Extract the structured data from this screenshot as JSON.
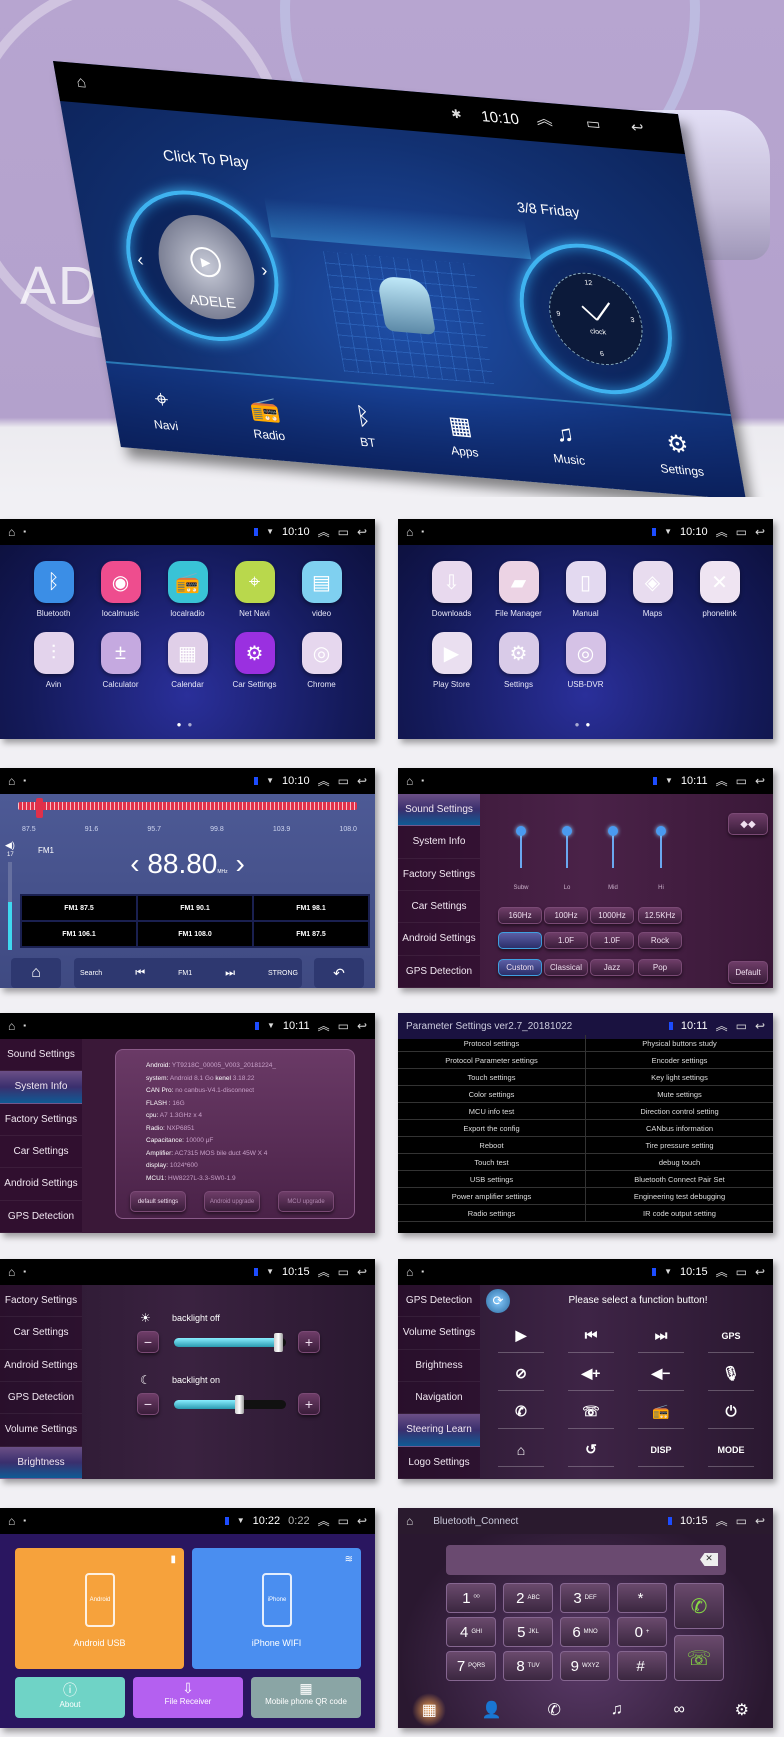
{
  "colors": {
    "accent": "#3fb3f0",
    "radio_needle": "#e0304a",
    "settings_bg": "#3a1838",
    "apps_bg": "#151c5c",
    "radio_bg": "#4a5690"
  },
  "hero": {
    "background_text": "AD",
    "time": "10:10",
    "click_to_play": "Click To Play",
    "album_text": "ADELE",
    "date": "3/8 Friday",
    "clock_label": "clock",
    "clock_numbers": [
      "12",
      "3",
      "6",
      "9"
    ],
    "dock": [
      {
        "label": "Navi",
        "icon": "location-pin-icon"
      },
      {
        "label": "Radio",
        "icon": "radio-icon"
      },
      {
        "label": "BT",
        "icon": "bluetooth-icon"
      },
      {
        "label": "Apps",
        "icon": "apps-grid-icon"
      },
      {
        "label": "Music",
        "icon": "music-note-icon"
      },
      {
        "label": "Settings",
        "icon": "gear-icon"
      }
    ]
  },
  "apps_page1": {
    "time": "10:10",
    "page": 1,
    "pages": 2,
    "apps": [
      {
        "label": "Bluetooth",
        "icon": "bluetooth-icon",
        "color": "#3b8ee6"
      },
      {
        "label": "localmusic",
        "icon": "music-disc-icon",
        "color": "#ee4d8e"
      },
      {
        "label": "localradio",
        "icon": "radio-icon",
        "color": "#39c3d6"
      },
      {
        "label": "Net Navi",
        "icon": "location-pin-icon",
        "color": "#b9d84c"
      },
      {
        "label": "video",
        "icon": "clapperboard-icon",
        "color": "#7fd0f0"
      },
      {
        "label": "Avin",
        "icon": "av-cable-icon",
        "color": "#e3d3ec"
      },
      {
        "label": "Calculator",
        "icon": "calculator-icon",
        "color": "#c5a9e0"
      },
      {
        "label": "Calendar",
        "icon": "calendar-icon",
        "color": "#e0cfe8"
      },
      {
        "label": "Car Settings",
        "icon": "gear-icon",
        "color": "#9a30e0"
      },
      {
        "label": "Chrome",
        "icon": "chrome-icon",
        "color": "#e6d7ee"
      }
    ]
  },
  "apps_page2": {
    "time": "10:10",
    "page": 2,
    "pages": 2,
    "apps": [
      {
        "label": "Downloads",
        "icon": "download-icon",
        "color": "#e8d9ee"
      },
      {
        "label": "File Manager",
        "icon": "folder-icon",
        "color": "#ecd3e4"
      },
      {
        "label": "Manual",
        "icon": "book-icon",
        "color": "#e3d9f0"
      },
      {
        "label": "Maps",
        "icon": "maps-icon",
        "color": "#e8dcef"
      },
      {
        "label": "phonelink",
        "icon": "phonelink-icon",
        "color": "#efe4f2"
      },
      {
        "label": "Play Store",
        "icon": "play-store-icon",
        "color": "#eadff0"
      },
      {
        "label": "Settings",
        "icon": "gear-icon",
        "color": "#d9cbe8"
      },
      {
        "label": "USB-DVR",
        "icon": "camera-lens-icon",
        "color": "#d5c2e6"
      }
    ]
  },
  "radio": {
    "time": "10:10",
    "scale": [
      "87.5",
      "91.6",
      "95.7",
      "99.8",
      "103.9",
      "108.0"
    ],
    "tuned_fraction": 0.063,
    "band": "FM1",
    "frequency": "88.80",
    "unit": "MHz",
    "volume": "17",
    "volume_fraction": 0.55,
    "presets": [
      "FM1 87.5",
      "FM1 90.1",
      "FM1 98.1",
      "FM1 106.1",
      "FM1 108.0",
      "FM1 87.5"
    ],
    "controls": {
      "search": "Search",
      "band": "FM1",
      "strong": "STRONG"
    }
  },
  "sound": {
    "time": "10:11",
    "menu": [
      "Sound Settings",
      "System Info",
      "Factory Settings",
      "Car Settings",
      "Android Settings",
      "GPS Detection"
    ],
    "active": 0,
    "bands": [
      {
        "label": "Subw",
        "level": 1.0
      },
      {
        "label": "Lo",
        "level": 1.0
      },
      {
        "label": "Mid",
        "level": 1.0
      },
      {
        "label": "Hi",
        "level": 1.0
      }
    ],
    "freqs": [
      "160Hz",
      "100Hz",
      "1000Hz",
      "12.5KHz"
    ],
    "q_row": [
      "",
      "1.0F",
      "1.0F",
      "Rock"
    ],
    "presets": [
      "Custom",
      "Classical",
      "Jazz",
      "Pop"
    ],
    "default": "Default"
  },
  "system_info": {
    "time": "10:11",
    "menu": [
      "Sound Settings",
      "System Info",
      "Factory Settings",
      "Car Settings",
      "Android Settings",
      "GPS Detection"
    ],
    "active": 1,
    "rows": [
      {
        "k": "Android:",
        "v": "YT9218C_00005_V003_20181224_"
      },
      {
        "k": "system:",
        "v": "Android 8.1 Go",
        "k2": "kenel",
        "v2": "3.18.22"
      },
      {
        "k": "CAN Pro:",
        "v": "no canbus-V4.1-disconnect"
      },
      {
        "k": "FLASH :",
        "v": "16G"
      },
      {
        "k": "cpu:",
        "v": "A7 1.3GHz x 4"
      },
      {
        "k": "Radio:",
        "v": "NXP6851"
      },
      {
        "k": "Capacitance:",
        "v": "10000 μF"
      },
      {
        "k": "Amplifier:",
        "v": "AC7315 MOS bile duct 45W X 4"
      },
      {
        "k": "display:",
        "v": "1024*600"
      },
      {
        "k": "MCU1:",
        "v": "HW8227L-3.3-SW0-1.9"
      }
    ],
    "buttons": [
      "default settings",
      "Android upgrade",
      "MCU upgrade"
    ]
  },
  "params": {
    "title": "Parameter Settings ver2.7_20181022",
    "time": "10:11",
    "left": [
      "Protocol settings",
      "Protocol Parameter settings",
      "Touch settings",
      "Color settings",
      "MCU info test",
      "Export the config",
      "Reboot",
      "Touch test",
      "USB settings",
      "Power amplifier settings",
      "Radio settings"
    ],
    "right": [
      "Physical buttons study",
      "Encoder settings",
      "Key light settings",
      "Mute settings",
      "Direction control setting",
      "CANbus information",
      "Tire pressure setting",
      "debug touch",
      "Bluetooth Connect Pair Set",
      "Engineering test debugging",
      "IR code output setting"
    ]
  },
  "brightness": {
    "time": "10:15",
    "menu": [
      "Factory Settings",
      "Car Settings",
      "Android Settings",
      "GPS Detection",
      "Volume Settings",
      "Brightness"
    ],
    "active": 5,
    "sliders": [
      {
        "label": "backlight off",
        "icon": "sun-icon",
        "value": 0.95
      },
      {
        "label": "backlight on",
        "icon": "moon-icon",
        "value": 0.6
      }
    ]
  },
  "steering": {
    "time": "10:15",
    "menu": [
      "GPS Detection",
      "Volume Settings",
      "Brightness",
      "Navigation",
      "Steering Learn",
      "Logo Settings"
    ],
    "active": 4,
    "prompt": "Please select a function button!",
    "buttons": [
      {
        "icon": "play-icon"
      },
      {
        "icon": "previous-track-icon"
      },
      {
        "icon": "next-track-icon"
      },
      {
        "text": "GPS"
      },
      {
        "icon": "mute-icon"
      },
      {
        "icon": "volume-up-icon"
      },
      {
        "icon": "volume-down-icon"
      },
      {
        "icon": "microphone-icon"
      },
      {
        "icon": "phone-icon"
      },
      {
        "icon": "hang-up-icon"
      },
      {
        "icon": "radio-icon"
      },
      {
        "icon": "power-icon"
      },
      {
        "icon": "home-icon"
      },
      {
        "icon": "back-icon"
      },
      {
        "text": "DISP"
      },
      {
        "text": "MODE"
      }
    ]
  },
  "phonelink": {
    "time": "10:22",
    "time_overlay": "0:22",
    "tiles": [
      {
        "label": "Android USB",
        "phone_text": "Android",
        "color": "#f6a23c"
      },
      {
        "label": "iPhone WIFI",
        "phone_text": "iPhone",
        "color": "#4a8ef0"
      }
    ],
    "small": [
      {
        "label": "About",
        "color": "#6fd3c6"
      },
      {
        "label": "File Receiver",
        "color": "#b460f0"
      },
      {
        "label": "Mobile phone QR code",
        "color": "#8aa5a5"
      }
    ]
  },
  "bluetooth": {
    "title": "Bluetooth_Connect",
    "time": "10:15",
    "keys": [
      {
        "d": "1",
        "s": "ᴼᴼ"
      },
      {
        "d": "2",
        "s": "ABC"
      },
      {
        "d": "3",
        "s": "DEF"
      },
      {
        "d": "*",
        "s": ""
      },
      {
        "d": "4",
        "s": "GHI"
      },
      {
        "d": "5",
        "s": "JKL"
      },
      {
        "d": "6",
        "s": "MNO"
      },
      {
        "d": "0",
        "s": "+"
      },
      {
        "d": "7",
        "s": "PQRS"
      },
      {
        "d": "8",
        "s": "TUV"
      },
      {
        "d": "9",
        "s": "WXYZ"
      },
      {
        "d": "#",
        "s": ""
      }
    ],
    "tabs": [
      "dialpad-icon",
      "contacts-icon",
      "call-log-icon",
      "music-note-icon",
      "link-icon",
      "gear-icon"
    ]
  }
}
